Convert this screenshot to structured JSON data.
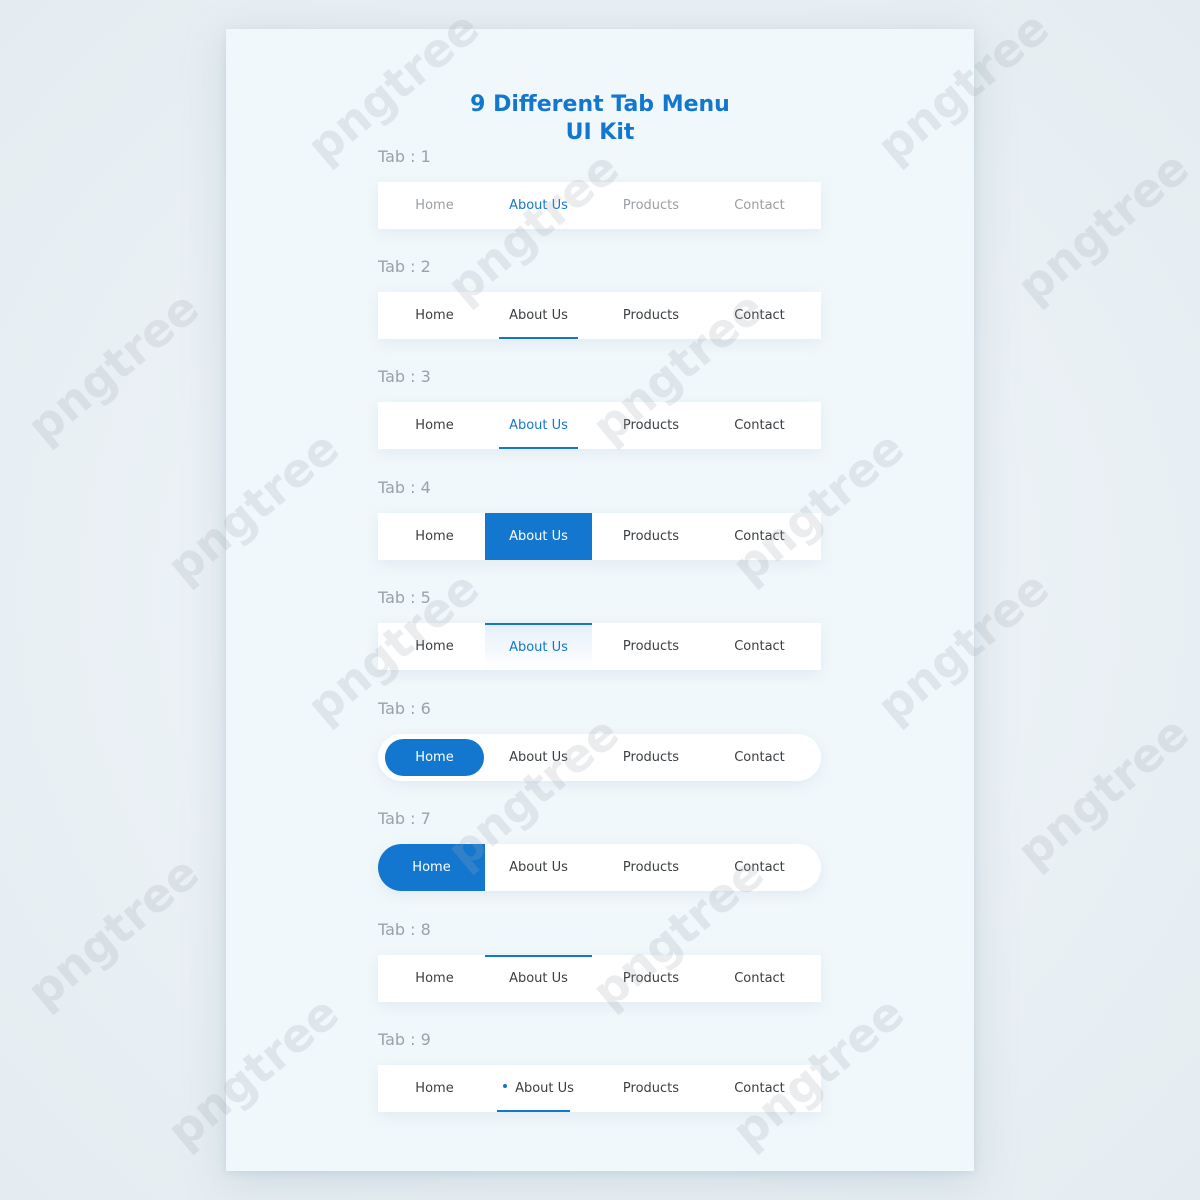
{
  "title_line1": "9 Different Tab Menu",
  "title_line2": "UI Kit",
  "watermark": "pngtree",
  "accent": "#1377cf",
  "tabs": [
    {
      "label": "Tab : 1",
      "items": [
        "Home",
        "About Us",
        "Products",
        "Contact"
      ],
      "style": "text-highlight"
    },
    {
      "label": "Tab : 2",
      "items": [
        "Home",
        "About Us",
        "Products",
        "Contact"
      ],
      "style": "underline"
    },
    {
      "label": "Tab : 3",
      "items": [
        "Home",
        "About Us",
        "Products",
        "Contact"
      ],
      "style": "underline-color"
    },
    {
      "label": "Tab : 4",
      "items": [
        "Home",
        "About Us",
        "Products",
        "Contact"
      ],
      "style": "solid-block"
    },
    {
      "label": "Tab : 5",
      "items": [
        "Home",
        "About Us",
        "Products",
        "Contact"
      ],
      "style": "top-border-gradient"
    },
    {
      "label": "Tab : 6",
      "items": [
        "Home",
        "About Us",
        "Products",
        "Contact"
      ],
      "style": "pill"
    },
    {
      "label": "Tab : 7",
      "items": [
        "Home",
        "About Us",
        "Products",
        "Contact"
      ],
      "style": "rounded-left"
    },
    {
      "label": "Tab : 8",
      "items": [
        "Home",
        "About Us",
        "Products",
        "Contact"
      ],
      "style": "top-line"
    },
    {
      "label": "Tab : 9",
      "items": [
        "Home",
        "About Us",
        "Products",
        "Contact"
      ],
      "style": "dot-underline"
    }
  ]
}
